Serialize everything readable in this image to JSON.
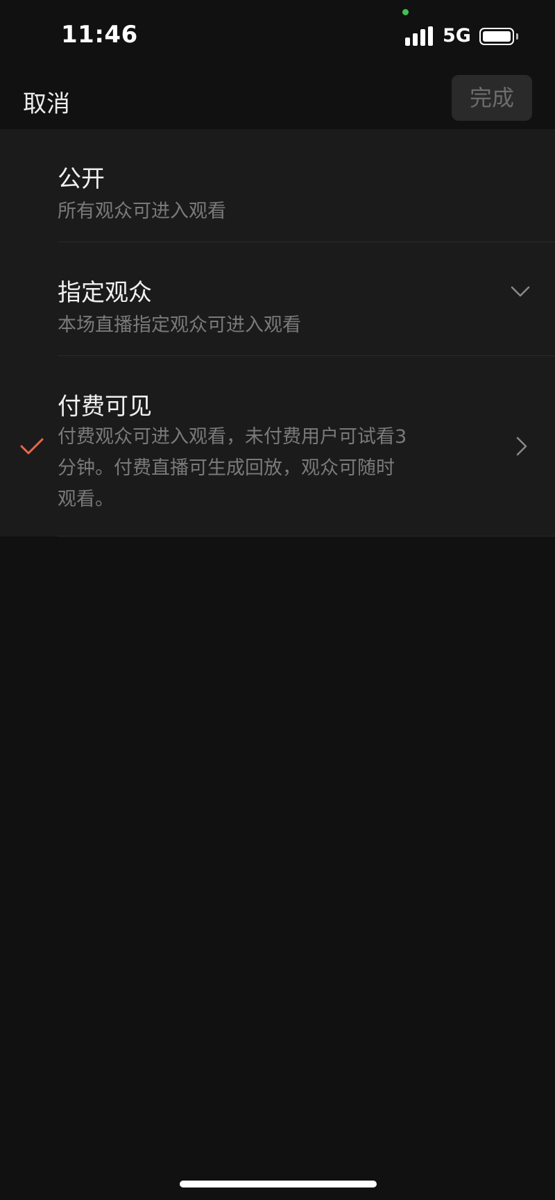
{
  "status_bar": {
    "time": "11:46",
    "network": "5G",
    "privacy_dot_color": "#3fc24f"
  },
  "nav": {
    "cancel_label": "取消",
    "done_label": "完成"
  },
  "options": [
    {
      "title": "公开",
      "description": "所有观众可进入观看",
      "selected": false,
      "indicator": "none"
    },
    {
      "title": "指定观众",
      "description": "本场直播指定观众可进入观看",
      "selected": false,
      "indicator": "chevron-down-icon"
    },
    {
      "title": "付费可见",
      "description": "付费观众可进入观看，未付费用户可试看3分钟。付费直播可生成回放，观众可随时观看。",
      "selected": true,
      "indicator": "chevron-right-icon"
    }
  ],
  "colors": {
    "accent_check": "#e8684a",
    "background": "#111111",
    "panel": "#1b1b1b",
    "done_button_bg": "#2a2a2a"
  }
}
